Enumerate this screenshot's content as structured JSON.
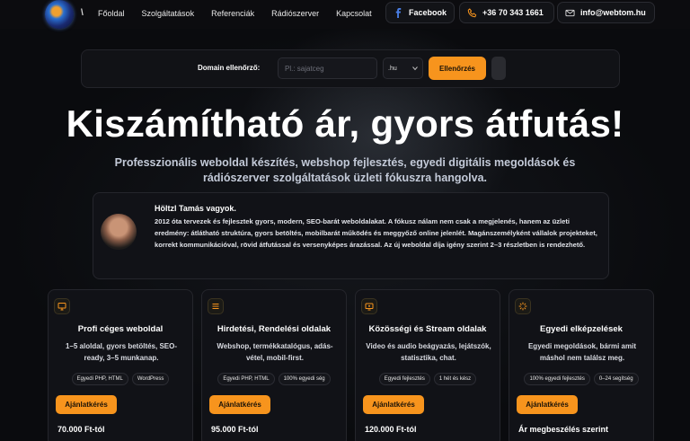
{
  "nav": {
    "logo_mark": "\\",
    "items": [
      "Főoldal",
      "Szolgáltatások",
      "Referenciák",
      "Rádiószerver",
      "Kapcsolat"
    ],
    "facebook": "Facebook",
    "phone": "+36 70 343 1661",
    "email": "info@webtom.hu"
  },
  "domain": {
    "label": "Domain ellenőrző:",
    "placeholder": "Pl.: sajatceg",
    "tld": ".hu",
    "button": "Ellenőrzés"
  },
  "hero": {
    "title": "Kiszámítható ár, gyors átfutás!",
    "subtitle": "Professzionális weboldal készítés, webshop fejlesztés, egyedi digitális megoldások és rádiószerver szolgáltatások üzleti fókuszra hangolva."
  },
  "about": {
    "name": "Höltzl Tamás vagyok.",
    "text": "2012 óta tervezek és fejlesztek gyors, modern, SEO-barát weboldalakat. A fókusz nálam nem csak a megjelenés, hanem az üzleti eredmény: átlátható struktúra, gyors betöltés, mobilbarát működés és meggyőző online jelenlét. Magánszemélyként vállalok projekteket, korrekt kommunikációval, rövid átfutással és versenyképes árazással. Az új weboldal díja igény szerint 2–3 részletben is rendezhető."
  },
  "cards": [
    {
      "icon": "monitor-icon",
      "title": "Profi céges weboldal",
      "desc": "1–5 aloldal, gyors betöltés, SEO-ready, 3–5 munkanap.",
      "tags": [
        "Egyedi PHP, HTML",
        "WordPress"
      ],
      "button": "Ajánlatkérés",
      "price": "70.000 Ft-tól"
    },
    {
      "icon": "list-icon",
      "title": "Hirdetési, Rendelési oldalak",
      "desc": "Webshop, termékkatalógus, adás-vétel, mobil-first.",
      "tags": [
        "Egyedi PHP, HTML",
        "100% egyedi ség"
      ],
      "button": "Ajánlatkérés",
      "price": "95.000 Ft-tól"
    },
    {
      "icon": "broadcast-icon",
      "title": "Közösségi és Stream oldalak",
      "desc": "Video és audio beágyazás, lejátszók, statisztika, chat.",
      "tags": [
        "Egyedi fejlesztés",
        "1 hét és kész"
      ],
      "button": "Ajánlatkérés",
      "price": "120.000 Ft-tól"
    },
    {
      "icon": "spinner-icon",
      "title": "Egyedi elképzelések",
      "desc": "Egyedi megoldások, bármi amit máshol nem találsz meg.",
      "tags": [
        "100% egyedi fejlesztés",
        "0–24 segítség"
      ],
      "button": "Ajánlatkérés",
      "price": "Ár megbeszélés szerint"
    }
  ]
}
